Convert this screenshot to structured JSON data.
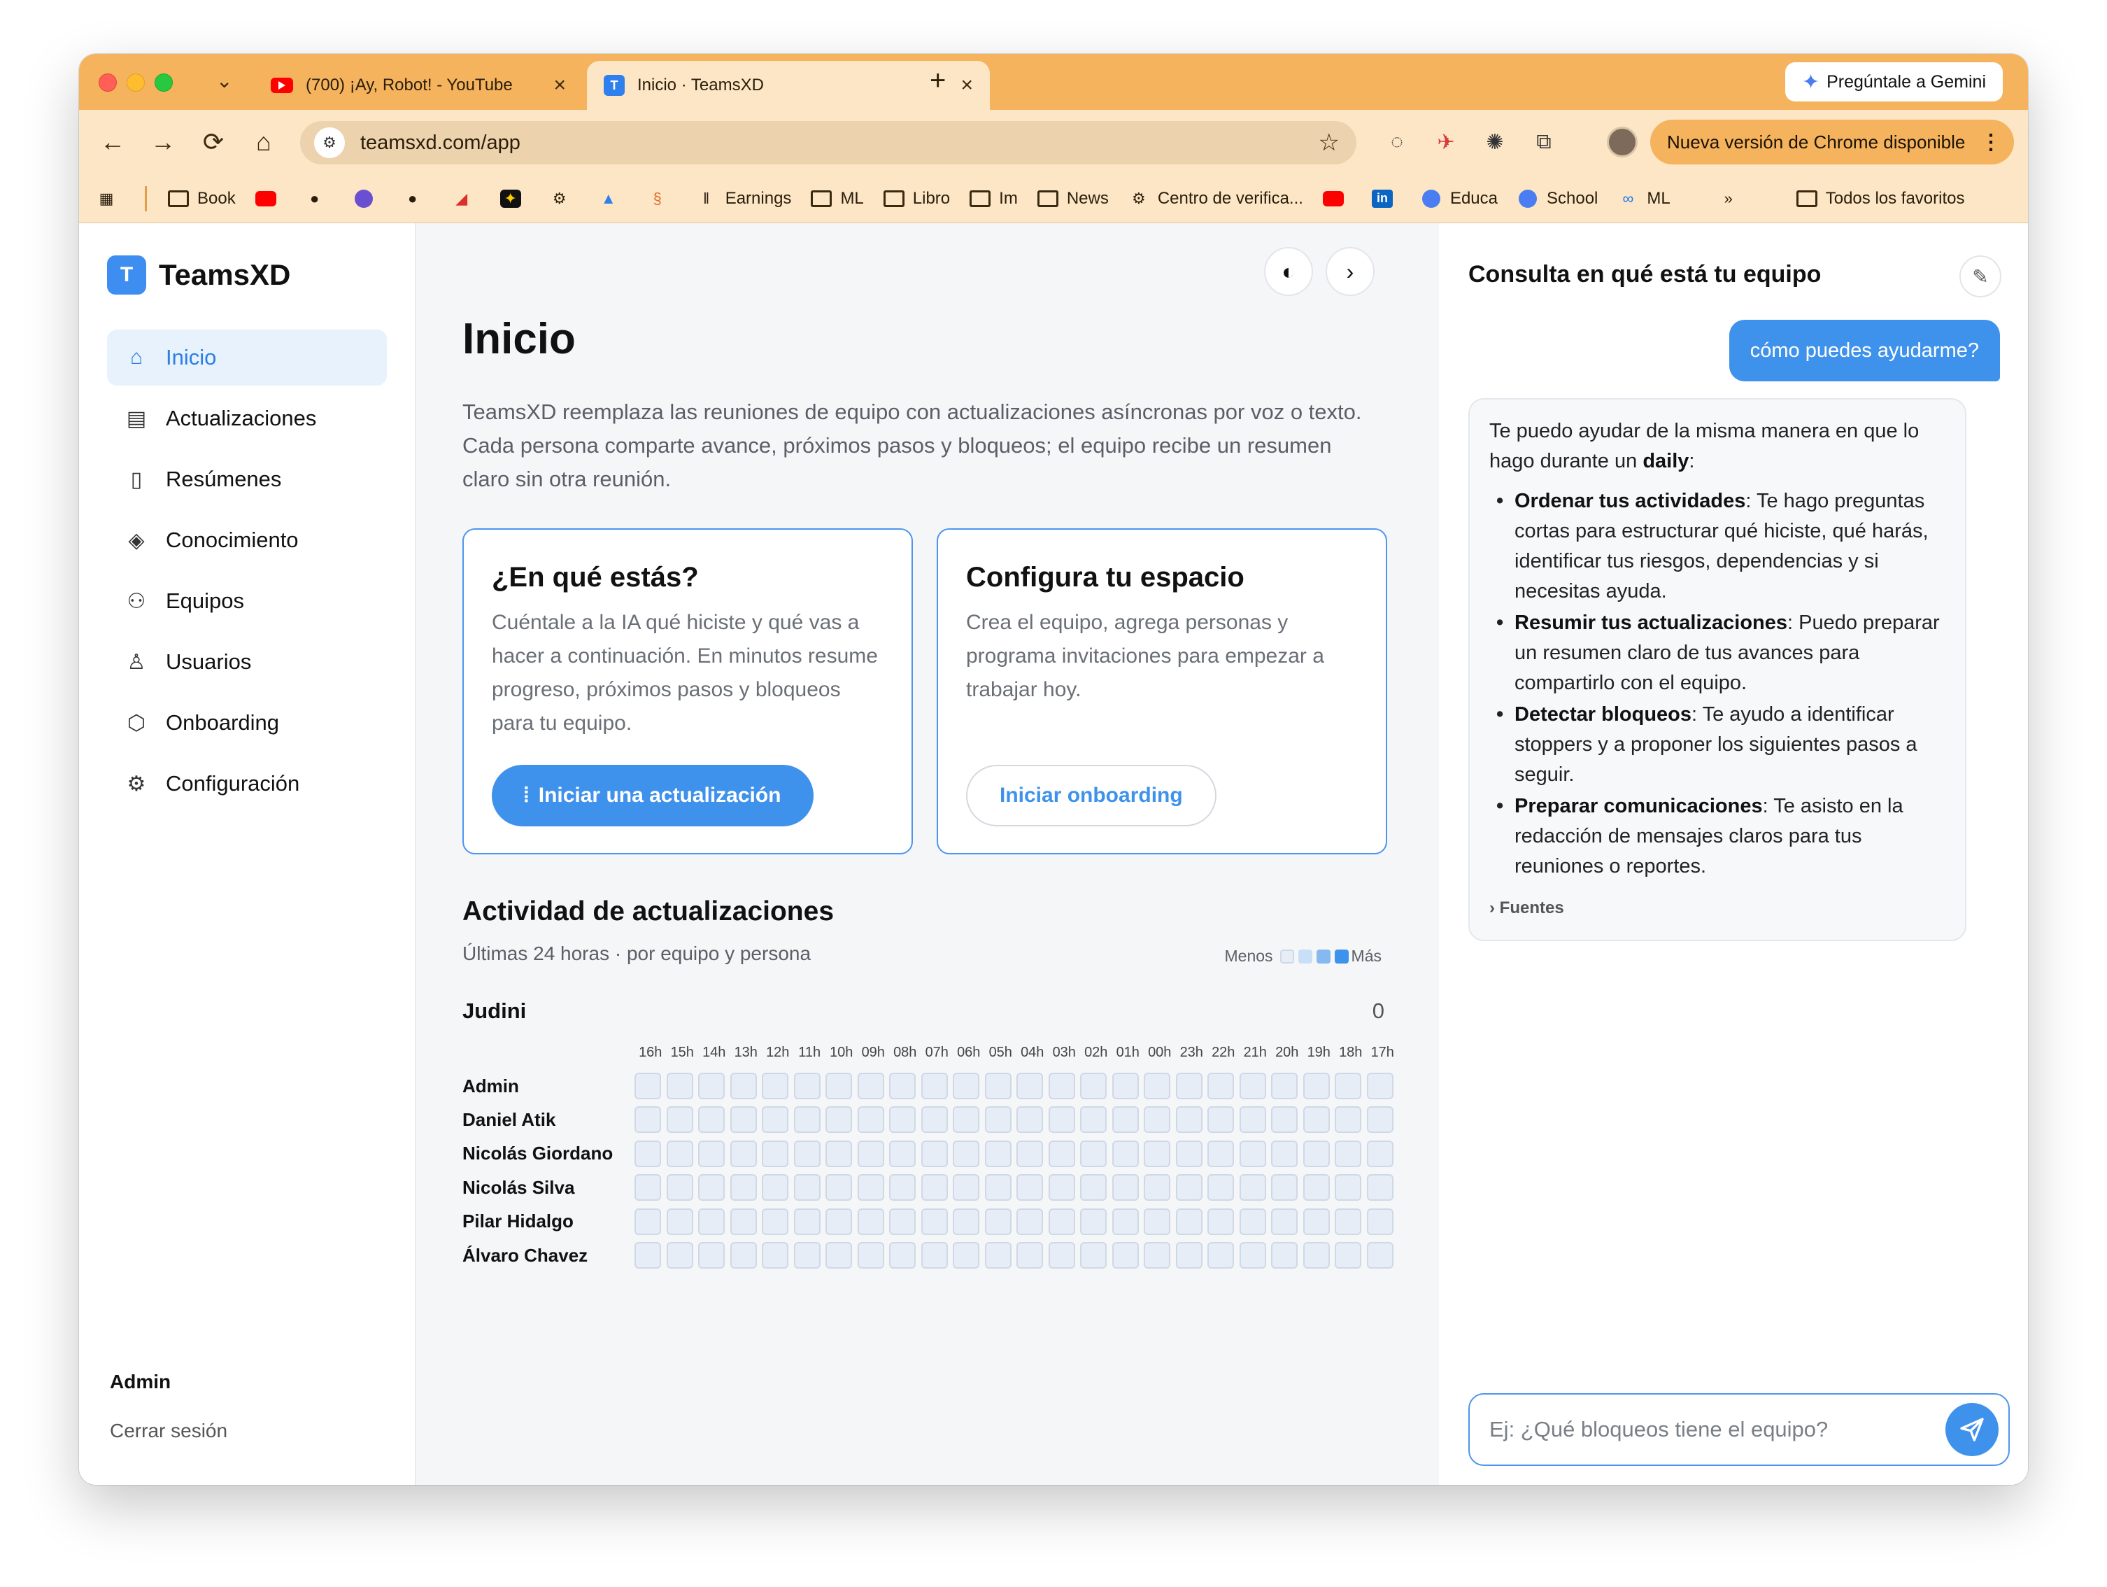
{
  "browser": {
    "tabs": [
      {
        "title": "(700) ¡Ay, Robot! - YouTube",
        "active": false
      },
      {
        "title": "Inicio · TeamsXD",
        "active": true
      }
    ],
    "gemini_label": "Pregúntale a Gemini",
    "url": "teamsxd.com/app",
    "update_label": "Nueva versión de Chrome disponible",
    "bookmarks": {
      "book": "Book",
      "earnings": "Earnings",
      "ml": "ML",
      "libro": "Libro",
      "im": "Im",
      "news": "News",
      "centro": "Centro de verifica...",
      "educa": "Educa",
      "school": "School",
      "ml2": "ML",
      "todos": "Todos los favoritos"
    }
  },
  "sidebar": {
    "brand_initial": "T",
    "brand_name": "TeamsXD",
    "items": [
      {
        "label": "Inicio"
      },
      {
        "label": "Actualizaciones"
      },
      {
        "label": "Resúmenes"
      },
      {
        "label": "Conocimiento"
      },
      {
        "label": "Equipos"
      },
      {
        "label": "Usuarios"
      },
      {
        "label": "Onboarding"
      },
      {
        "label": "Configuración"
      }
    ],
    "user": "Admin",
    "logout": "Cerrar sesión"
  },
  "main": {
    "title": "Inicio",
    "intro": "TeamsXD reemplaza las reuniones de equipo con actualizaciones asíncronas por voz o texto. Cada persona comparte avance, próximos pasos y bloqueos; el equipo recibe un resumen claro sin otra reunión.",
    "card1": {
      "title": "¿En qué estás?",
      "body": "Cuéntale a la IA qué hiciste y qué vas a hacer a continuación. En minutos resume progreso, próximos pasos y bloqueos para tu equipo.",
      "button": "Iniciar una actualización"
    },
    "card2": {
      "title": "Configura tu espacio",
      "body": "Crea el equipo, agrega personas y programa invitaciones para empezar a trabajar hoy.",
      "button": "Iniciar onboarding"
    },
    "activity": {
      "title": "Actividad de actualizaciones",
      "subtitle": "Últimas 24 horas · por equipo y persona",
      "legend_less": "Menos",
      "legend_more": "Más",
      "legend_colors": [
        "#e6edf6",
        "#c9dff7",
        "#86b9ef",
        "#3f92ec"
      ],
      "team": "Judini",
      "team_count": "0",
      "hours": [
        "16h",
        "15h",
        "14h",
        "13h",
        "12h",
        "11h",
        "10h",
        "09h",
        "08h",
        "07h",
        "06h",
        "05h",
        "04h",
        "03h",
        "02h",
        "01h",
        "00h",
        "23h",
        "22h",
        "21h",
        "20h",
        "19h",
        "18h",
        "17h"
      ],
      "people": [
        {
          "name": "Admin"
        },
        {
          "name": "Daniel Atik"
        },
        {
          "name": "Nicolás Giordano"
        },
        {
          "name": "Nicolás Silva"
        },
        {
          "name": "Pilar Hidalgo"
        },
        {
          "name": "Álvaro Chavez"
        }
      ]
    }
  },
  "chat": {
    "title": "Consulta en qué está tu equipo",
    "user_message": "cómo puedes ayudarme?",
    "bot": {
      "intro_pre": "Te puedo ayudar de la misma manera en que lo hago durante un ",
      "intro_bold": "daily",
      "intro_post": ":",
      "items": [
        {
          "bold": "Ordenar tus actividades",
          "text": ": Te hago preguntas cortas para estructurar qué hiciste, qué harás, identificar tus riesgos, dependencias y si necesitas ayuda."
        },
        {
          "bold": "Resumir tus actualizaciones",
          "text": ": Puedo preparar un resumen claro de tus avances para compartirlo con el equipo."
        },
        {
          "bold": "Detectar bloqueos",
          "text": ": Te ayudo a identificar stoppers y a proponer los siguientes pasos a seguir."
        },
        {
          "bold": "Preparar comunicaciones",
          "text": ": Te asisto en la redacción de mensajes claros para tus reuniones o reportes."
        }
      ],
      "sources": "› Fuentes"
    },
    "input_placeholder": "Ej: ¿Qué bloqueos tiene el equipo?"
  }
}
